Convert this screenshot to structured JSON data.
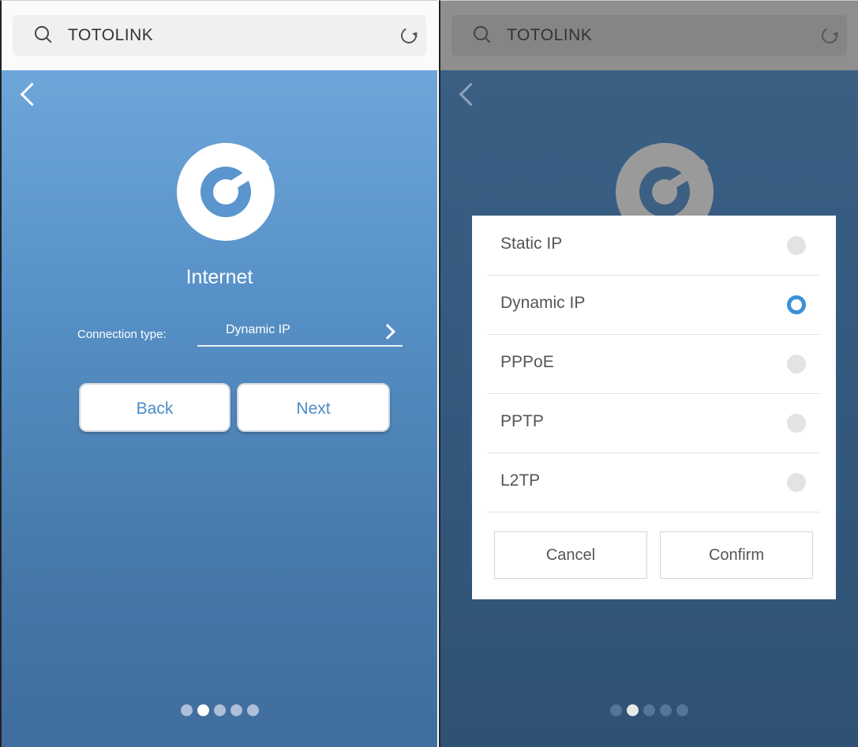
{
  "left": {
    "search_text": "TOTOLINK",
    "title": "Internet",
    "connection_label": "Connection type:",
    "connection_value": "Dynamic IP",
    "back_label": "Back",
    "next_label": "Next",
    "page_dots": {
      "count": 5,
      "active": 2
    }
  },
  "right": {
    "search_text": "TOTOLINK",
    "options": [
      {
        "label": "Static IP",
        "selected": false
      },
      {
        "label": "Dynamic IP",
        "selected": true
      },
      {
        "label": "PPPoE",
        "selected": false
      },
      {
        "label": "PPTP",
        "selected": false
      },
      {
        "label": "L2TP",
        "selected": false
      }
    ],
    "cancel_label": "Cancel",
    "confirm_label": "Confirm",
    "page_dots": {
      "count": 5,
      "active": 2
    }
  },
  "colors": {
    "accent": "#4b8cc6",
    "radio_selected": "#3b8fd8",
    "background_top": "#6ea6da"
  },
  "icons": [
    "search-icon",
    "reload-icon",
    "back-chevron-icon",
    "totolink-logo-icon",
    "chevron-right-icon"
  ]
}
